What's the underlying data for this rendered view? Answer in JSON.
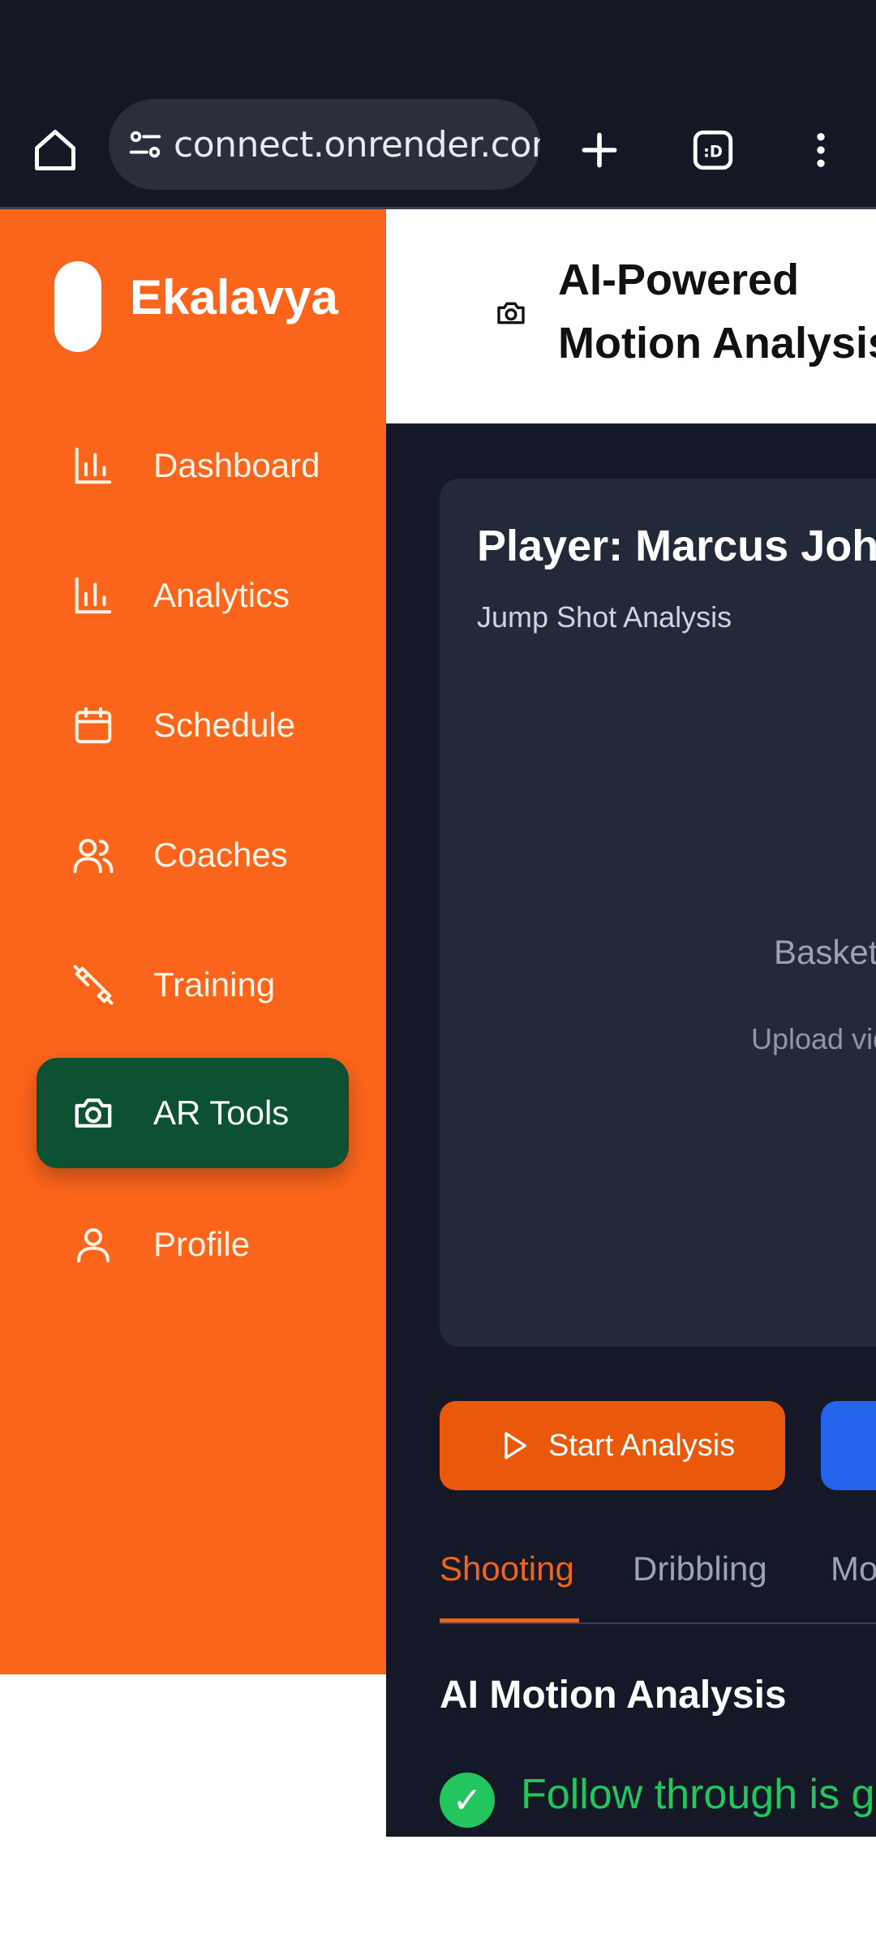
{
  "browser": {
    "url": "connect.onrender.com"
  },
  "sidebar": {
    "brand": "Ekalavya",
    "items": [
      {
        "label": "Dashboard",
        "icon": "bar-chart-icon"
      },
      {
        "label": "Analytics",
        "icon": "bar-chart-icon"
      },
      {
        "label": "Schedule",
        "icon": "calendar-icon"
      },
      {
        "label": "Coaches",
        "icon": "users-icon"
      },
      {
        "label": "Training",
        "icon": "dumbbell-icon"
      },
      {
        "label": "AR Tools",
        "icon": "camera-icon",
        "active": true
      },
      {
        "label": "Profile",
        "icon": "user-icon"
      }
    ]
  },
  "header": {
    "title_line1": "AI-Powered",
    "title_line2": "Motion Analysis"
  },
  "video_card": {
    "player": "Player: Marcus Johnson",
    "shot_type": "Jump Shot Analysis",
    "placeholder_title": "Basketball",
    "placeholder_hint": "Upload video"
  },
  "actions": {
    "start_analysis": "Start Analysis"
  },
  "tabs": [
    "Shooting",
    "Dribbling",
    "Movement"
  ],
  "analysis": {
    "section_title": "AI Motion Analysis",
    "feedback": "Follow through is good"
  },
  "colors": {
    "sidebar": "#fb641b",
    "active_nav": "#0b5132",
    "accent": "#ea580c",
    "main_bg": "#141827",
    "card_bg": "#222a39",
    "success": "#22c55e",
    "secondary_button": "#2563eb"
  }
}
